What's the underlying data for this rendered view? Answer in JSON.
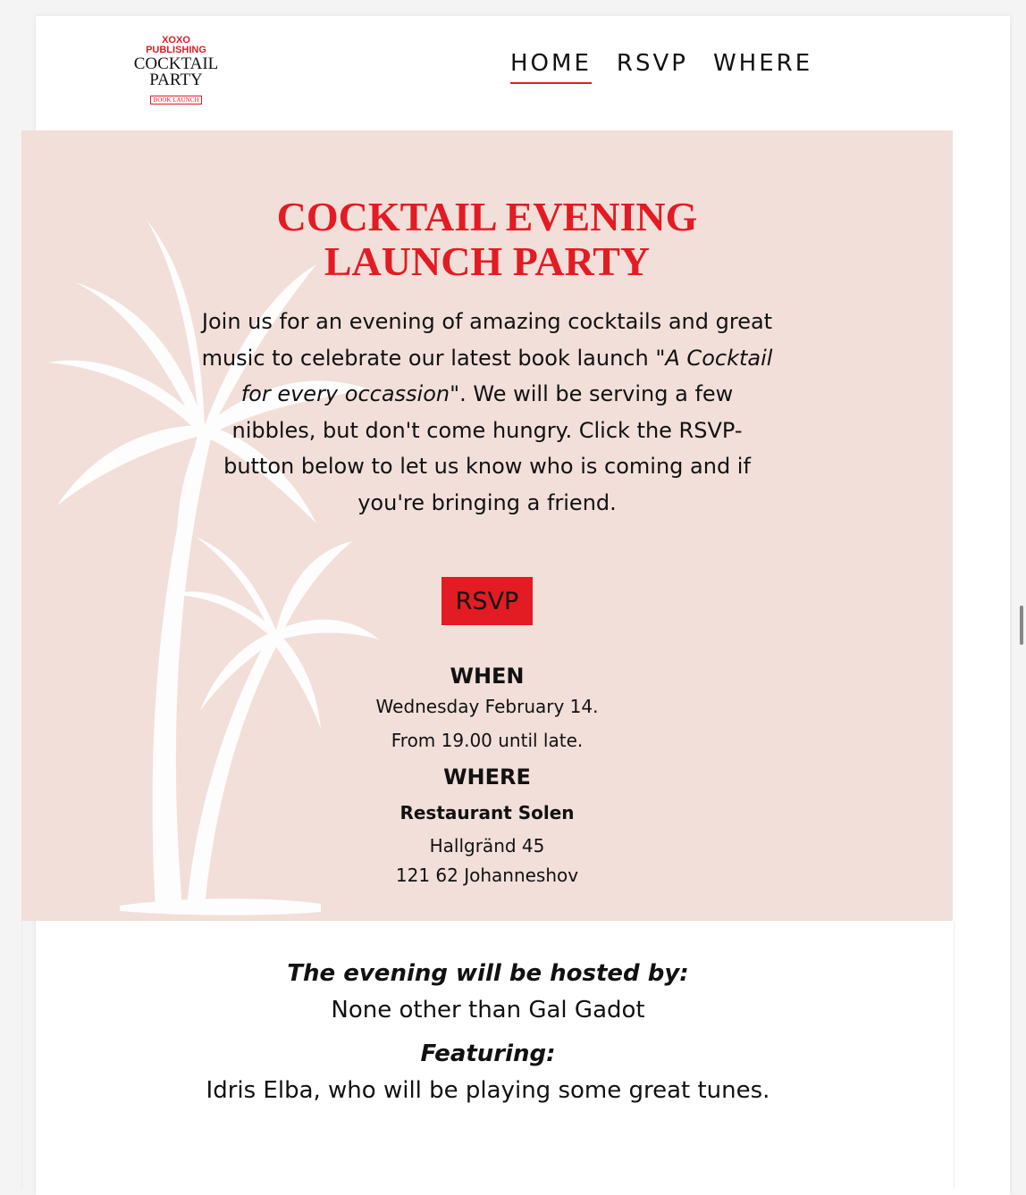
{
  "logo": {
    "line1": "XOXO",
    "line2": "PUBLISHING",
    "line3": "COCKTAIL",
    "line4": "PARTY",
    "tag": "BOOK LAUNCH"
  },
  "nav": {
    "items": [
      {
        "label": "HOME",
        "active": true
      },
      {
        "label": "RSVP",
        "active": false
      },
      {
        "label": "WHERE",
        "active": false
      }
    ]
  },
  "hero": {
    "title_line1": "COCKTAIL EVENING",
    "title_line2": "LAUNCH PARTY",
    "intro_before": "Join us for an evening of amazing cocktails and great music to celebrate our latest book launch",
    "book_title": "\"A Cocktail for every occassion\"",
    "intro_after": ". We will be serving a few nibbles, but don't come hungry. Click the RSVP-button below to let us know who is coming and if you're bringing a friend.",
    "rsvp_button": "RSVP"
  },
  "when": {
    "heading": "WHEN",
    "date": "Wednesday February 14.",
    "time": "From 19.00 until late."
  },
  "where": {
    "heading": "WHERE",
    "venue": "Restaurant Solen",
    "street": "Hallgränd 45",
    "city": "121 62 Johanneshov"
  },
  "host": {
    "hosted_heading": "The evening will be hosted by:",
    "hosted_by": "None other than Gal Gadot",
    "featuring_heading": "Featuring:",
    "featuring": "Idris Elba, who will be playing some great tunes."
  },
  "colors": {
    "accent": "#e31b23",
    "hero_bg": "#f2dfda"
  }
}
